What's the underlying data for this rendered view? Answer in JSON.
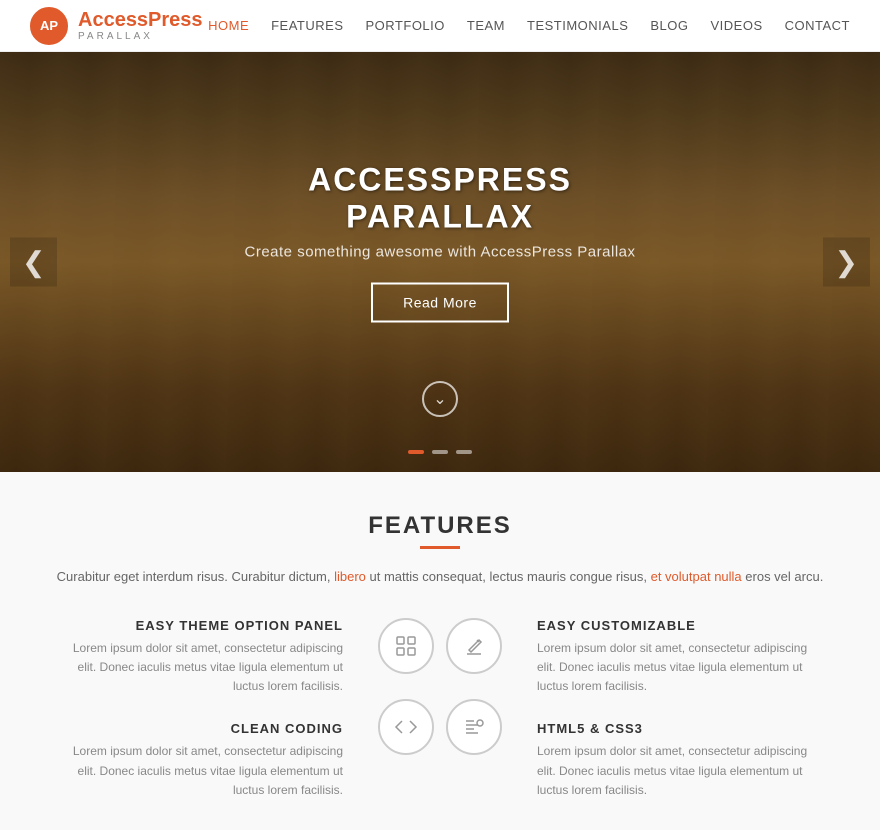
{
  "header": {
    "logo_initials": "AP",
    "logo_brand": "AccessPress",
    "logo_sub": "PARALLAX",
    "nav": [
      {
        "label": "HOME",
        "active": true,
        "id": "home"
      },
      {
        "label": "FEATURES",
        "active": false,
        "id": "features"
      },
      {
        "label": "PORTFOLIO",
        "active": false,
        "id": "portfolio"
      },
      {
        "label": "TEAM",
        "active": false,
        "id": "team"
      },
      {
        "label": "TESTIMONIALS",
        "active": false,
        "id": "testimonials"
      },
      {
        "label": "BLOG",
        "active": false,
        "id": "blog"
      },
      {
        "label": "VIDEOS",
        "active": false,
        "id": "videos"
      },
      {
        "label": "CONTACT",
        "active": false,
        "id": "contact"
      }
    ]
  },
  "hero": {
    "title": "ACCESSPRESS PARALLAX",
    "subtitle": "Create something awesome with AccessPress Parallax",
    "cta_label": "Read More",
    "scroll_icon": "❯",
    "arrow_left": "❮",
    "arrow_right": "❯",
    "dots": [
      {
        "active": true
      },
      {
        "active": false
      },
      {
        "active": false
      }
    ]
  },
  "features": {
    "section_title": "FEATURES",
    "description_parts": [
      {
        "text": "Curabitur eget interdum risus. Curabitur dictum, ",
        "link": false
      },
      {
        "text": "libero",
        "link": true
      },
      {
        "text": " ut mattis consequat, lectus mauris congue risus, ",
        "link": false
      },
      {
        "text": "et volutpat nulla",
        "link": true
      },
      {
        "text": " eros vel arcu.",
        "link": false
      }
    ],
    "left_items": [
      {
        "title": "EASY THEME OPTION PANEL",
        "desc": "Lorem ipsum dolor sit amet, consectetur adipiscing elit. Donec iaculis metus vitae ligula elementum ut luctus lorem facilisis.",
        "icon": "⊞"
      },
      {
        "title": "CLEAN CODING",
        "desc": "Lorem ipsum dolor sit amet, consectetur adipiscing elit. Donec iaculis metus vitae ligula elementum ut luctus lorem facilisis.",
        "icon": "✎"
      }
    ],
    "right_items": [
      {
        "title": "EASY CUSTOMIZABLE",
        "desc": "Lorem ipsum dolor sit amet, consectetur adipiscing elit. Donec iaculis metus vitae ligula elementum ut luctus lorem facilisis.",
        "icon": "✏"
      },
      {
        "title": "HTML5 & CSS3",
        "desc": "Lorem ipsum dolor sit amet, consectetur adipiscing elit. Donec iaculis metus vitae ligula elementum ut luctus lorem facilisis.",
        "icon": "⌥"
      }
    ]
  }
}
